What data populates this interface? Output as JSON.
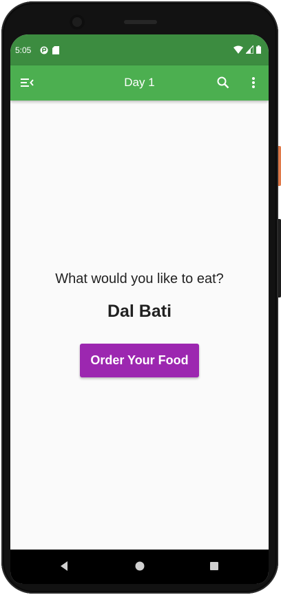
{
  "status_bar": {
    "time": "5:05"
  },
  "app_bar": {
    "title": "Day 1"
  },
  "content": {
    "question": "What would you like to eat?",
    "food_name": "Dal Bati",
    "order_button_label": "Order Your Food"
  },
  "icons": {
    "menu": "menu-icon",
    "search": "search-icon",
    "more": "more-vert-icon",
    "back": "back-icon",
    "home": "home-icon",
    "recents": "recents-icon"
  },
  "colors": {
    "status_bar": "#3c8c40",
    "app_bar": "#4caf50",
    "accent_button": "#9c27b0",
    "background": "#fafafa",
    "text": "#212121"
  }
}
